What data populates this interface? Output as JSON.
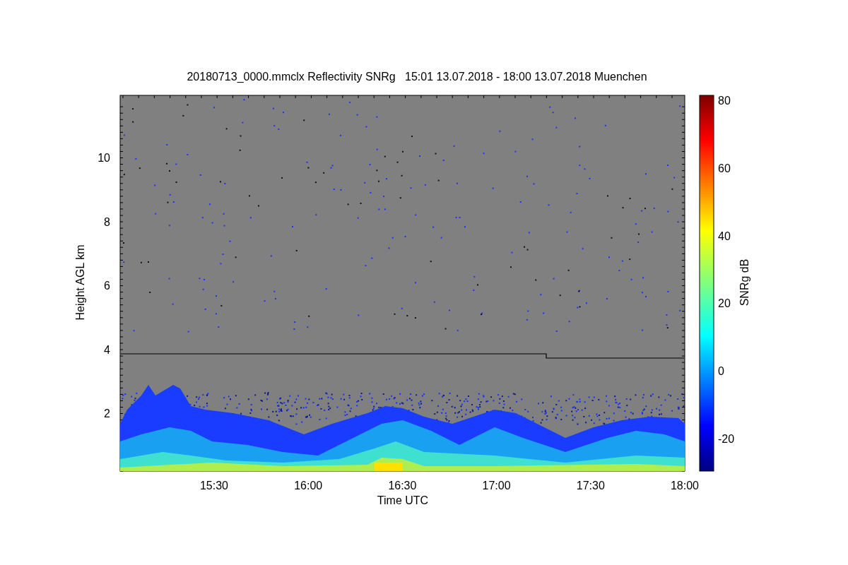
{
  "title": "20180713_0000.mmclx Reflectivity SNRg   15:01 13.07.2018 - 18:00 13.07.2018 Muenchen",
  "y_axis": {
    "label": "Height AGL km",
    "tick_labels": [
      "10",
      "8",
      "6",
      "4",
      "2"
    ]
  },
  "x_axis": {
    "label": "Time UTC",
    "tick_labels": [
      "15:30",
      "16:00",
      "16:30",
      "17:00",
      "17:30",
      "18:00"
    ]
  },
  "colorbar": {
    "label": "SNRg dB",
    "tick_labels": [
      "80",
      "60",
      "40",
      "20",
      "0",
      "-20"
    ]
  }
}
